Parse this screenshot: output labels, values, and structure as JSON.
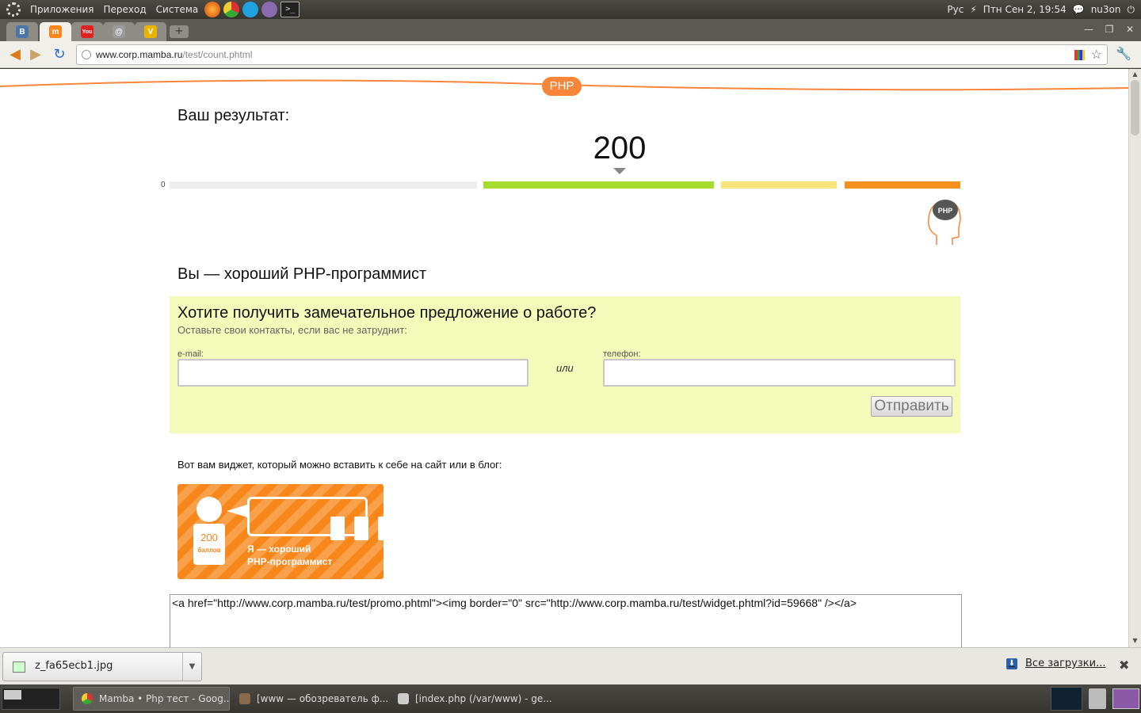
{
  "top_panel": {
    "menus": [
      "Приложения",
      "Переход",
      "Система"
    ],
    "keyboard_layout": "Рус",
    "clock": "Птн Сен  2, 19:54",
    "user": "nu3on"
  },
  "browser": {
    "tabs": [
      {
        "icon": "vk-icon",
        "glyph": "В",
        "color": "#4a76a8"
      },
      {
        "icon": "mamba-icon",
        "glyph": "m",
        "color": "#f7861b"
      },
      {
        "icon": "youtube-icon",
        "glyph": "You",
        "color": "#d22"
      },
      {
        "icon": "mail-icon",
        "glyph": "@",
        "color": "#9a9a9a"
      },
      {
        "icon": "v-icon",
        "glyph": "V",
        "color": "#e8b400"
      }
    ],
    "url_host": "www.corp.mamba.ru",
    "url_path": "/test/count.phtml"
  },
  "page": {
    "badge": "PHP",
    "result_label": "Ваш результат:",
    "score": "200",
    "score_value": 200,
    "scale_zero": "0",
    "scale_colors": [
      "#eeeeee",
      "#a6dc2e",
      "#f8e47a",
      "#f7901e"
    ],
    "head_badge": "PHP",
    "verdict": "Вы — хороший PHP-программист",
    "offer": {
      "title": "Хотите получить замечательное предложение о работе?",
      "subtitle": "Оставьте свои контакты, если вас не затруднит:",
      "email_label": "e-mail:",
      "email_value": "",
      "or": "или",
      "phone_label": "телефон:",
      "phone_value": "",
      "submit": "Отправить"
    },
    "widget_intro": "Вот вам виджет, который можно вставить к себе на сайт или в блог:",
    "widget": {
      "points": "200",
      "points_unit": "баллов",
      "line1": "Я — хороший",
      "line2": "PHP-программист"
    },
    "embed_code": "<a href=\"http://www.corp.mamba.ru/test/promo.phtml\"><img border=\"0\" src=\"http://www.corp.mamba.ru/test/widget.phtml?id=59668\" /></a>"
  },
  "downloads": {
    "file": "z_fa65ecb1.jpg",
    "all": "Все загрузки..."
  },
  "taskbar": {
    "tasks": [
      "Mamba • Php тест - Goog...",
      "[www — обозреватель ф...",
      "[index.php (/var/www) - ge..."
    ]
  }
}
